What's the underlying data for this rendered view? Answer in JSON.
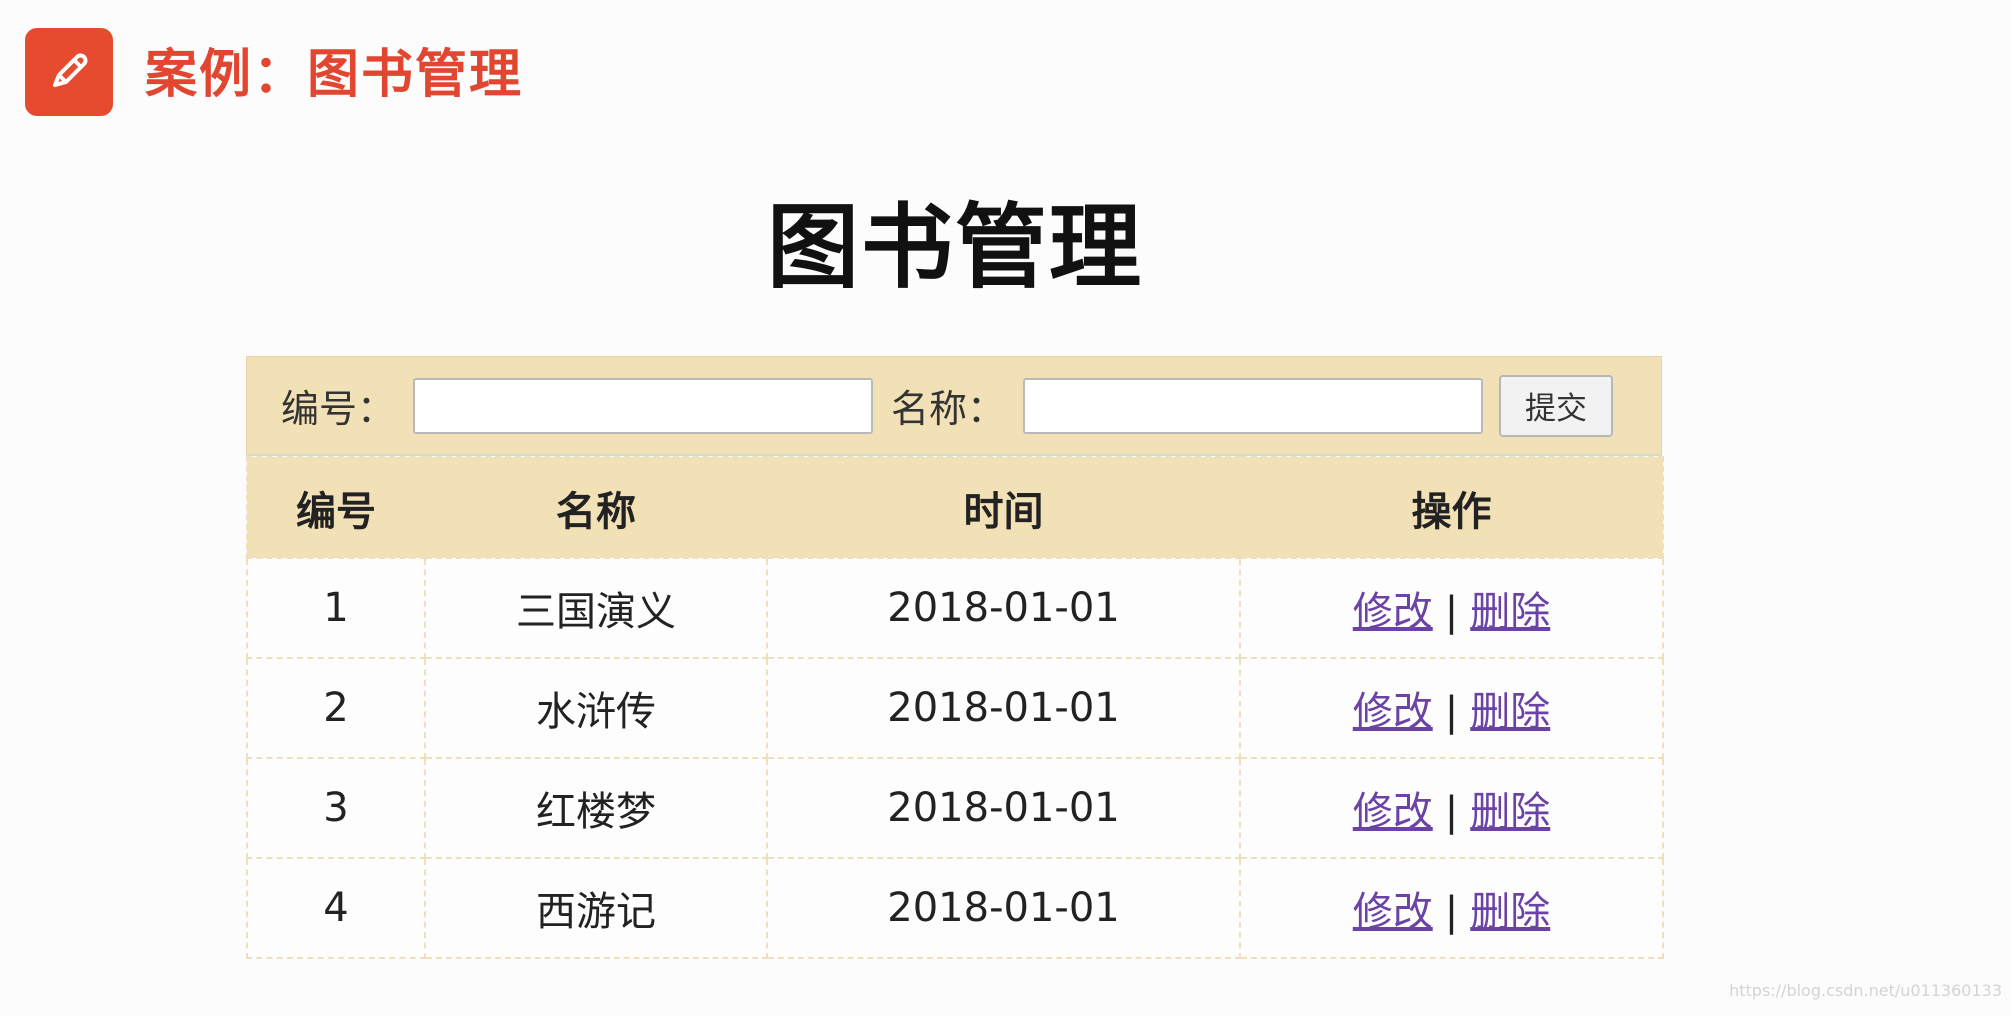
{
  "header": {
    "title": "案例：图书管理",
    "icon": "pencil-icon",
    "icon_color": "#e64a2f"
  },
  "page": {
    "title": "图书管理"
  },
  "form": {
    "id_label": "编号：",
    "name_label": "名称：",
    "id_value": "",
    "name_value": "",
    "submit_label": "提交"
  },
  "table": {
    "columns": [
      "编号",
      "名称",
      "时间",
      "操作"
    ],
    "rows": [
      {
        "id": "1",
        "name": "三国演义",
        "time": "2018-01-01",
        "edit": "修改",
        "separator": "|",
        "delete": "删除"
      },
      {
        "id": "2",
        "name": "水浒传",
        "time": "2018-01-01",
        "edit": "修改",
        "separator": "|",
        "delete": "删除"
      },
      {
        "id": "3",
        "name": "红楼梦",
        "time": "2018-01-01",
        "edit": "修改",
        "separator": "|",
        "delete": "删除"
      },
      {
        "id": "4",
        "name": "西游记",
        "time": "2018-01-01",
        "edit": "修改",
        "separator": "|",
        "delete": "删除"
      }
    ]
  },
  "watermark": "https://blog.csdn.net/u011360133",
  "colors": {
    "accent": "#e24631",
    "panel": "#f2e0b6",
    "link": "#6b43a6"
  }
}
